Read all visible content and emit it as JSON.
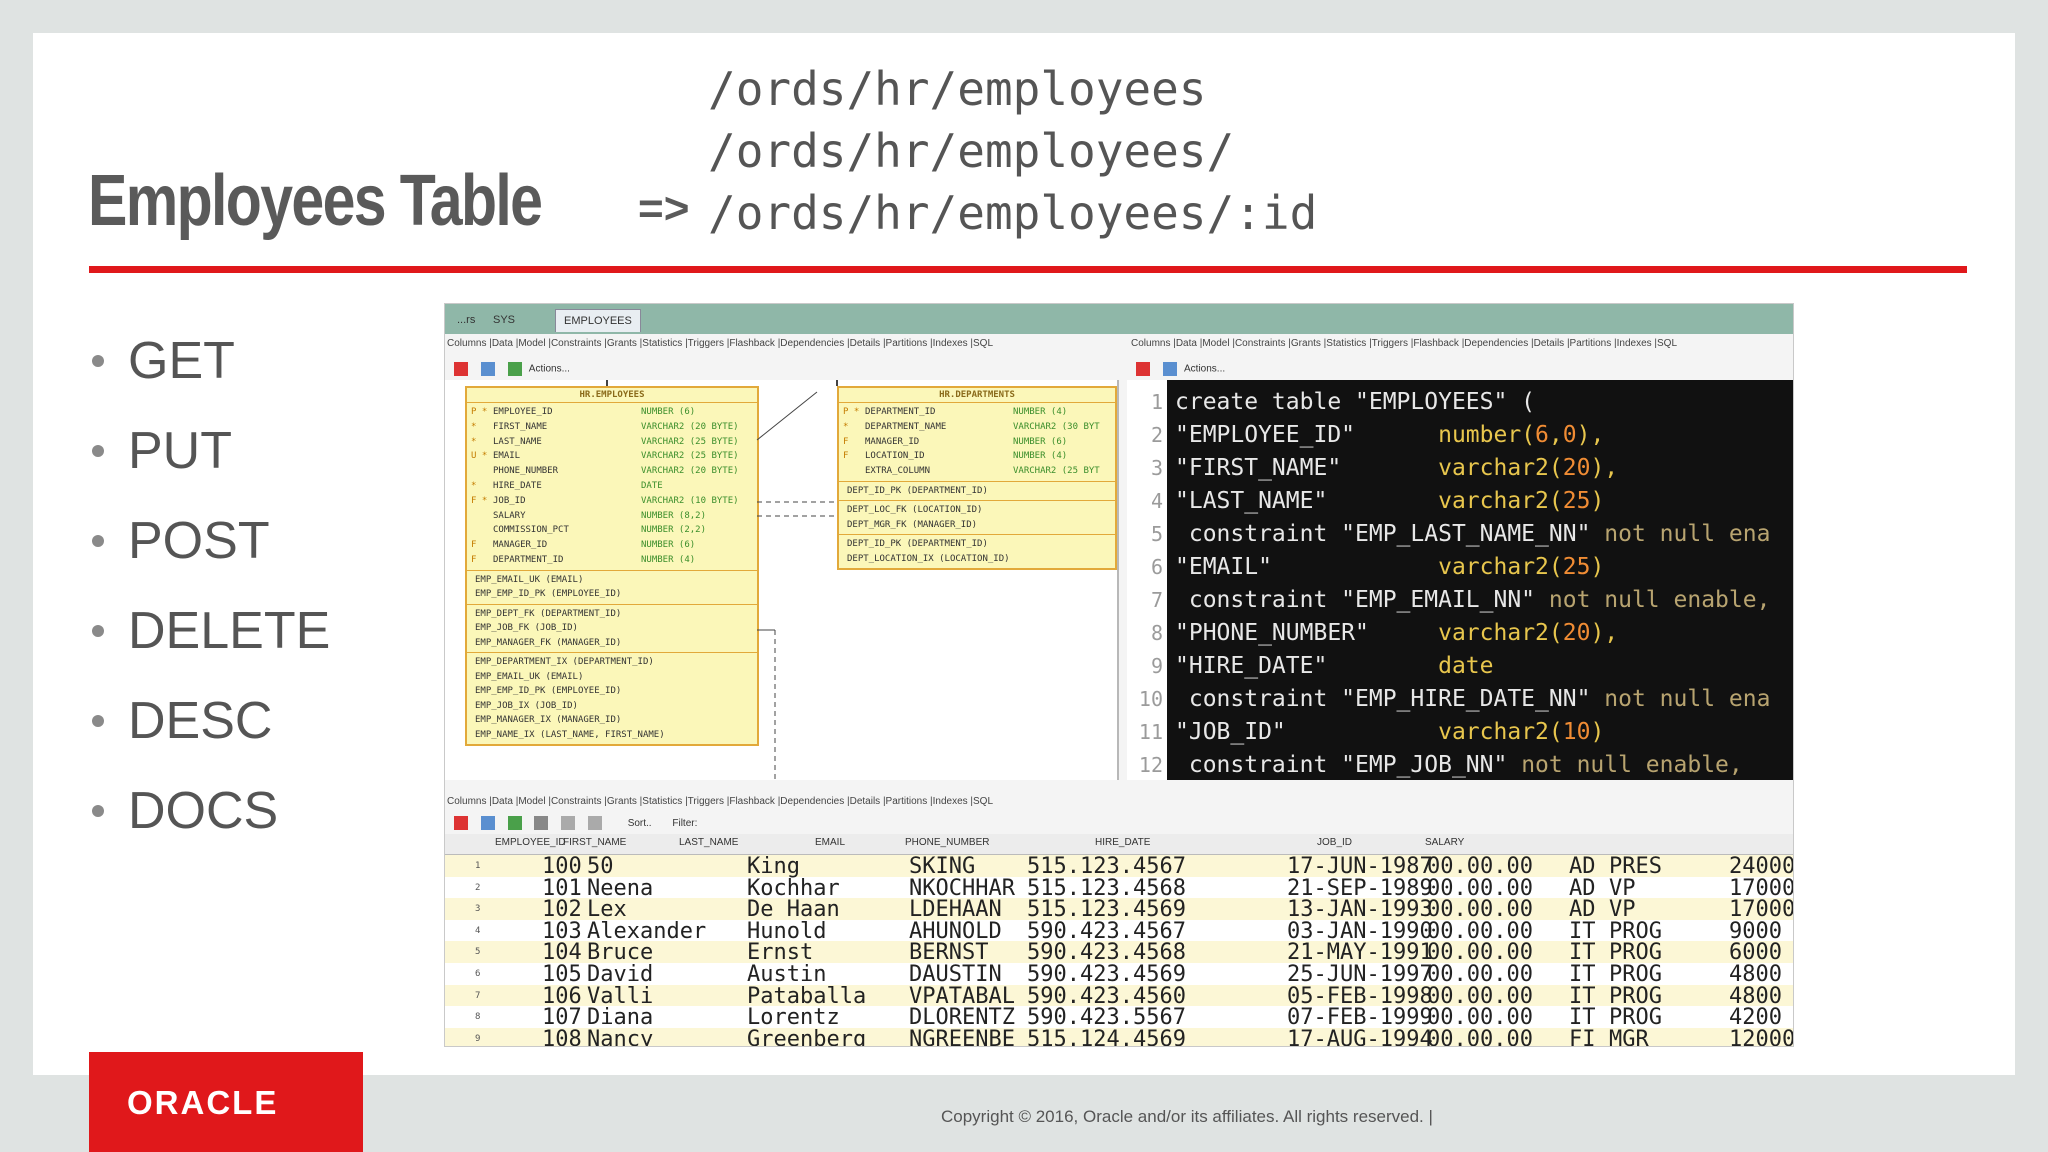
{
  "slide": {
    "title": "Employees Table",
    "arrow": "=>",
    "paths": [
      "/ords/hr/employees",
      "/ords/hr/employees/",
      "/ords/hr/employees/:id"
    ],
    "bullets": [
      "GET",
      "PUT",
      "POST",
      "DELETE",
      "DESC",
      "DOCS"
    ],
    "logo": "ORACLE",
    "copyright": "Copyright © 2016, Oracle and/or its affiliates. All rights reserved.  |"
  },
  "screenshot": {
    "tabs": [
      "...rs",
      "SYS",
      "EMPLOYEES"
    ],
    "subtabs_left": "Columns |Data |Model |Constraints |Grants |Statistics |Triggers |Flashback |Dependencies |Details |Partitions |Indexes |SQL",
    "subtabs_right": "Columns |Data |Model |Constraints |Grants |Statistics |Triggers |Flashback |Dependencies |Details |Partitions |Indexes |SQL",
    "subtabs_bottom": "Columns |Data |Model |Constraints |Grants |Statistics |Triggers |Flashback |Dependencies |Details |Partitions |Indexes |SQL",
    "actions_label": "Actions...",
    "sort_label": "Sort..",
    "filter_label": "Filter:",
    "employees_table": {
      "title": "HR.EMPLOYEES",
      "columns": [
        {
          "key": "P *",
          "name": "EMPLOYEE_ID",
          "type": "NUMBER (6)"
        },
        {
          "key": "*",
          "name": "FIRST_NAME",
          "type": "VARCHAR2 (20 BYTE)"
        },
        {
          "key": "*",
          "name": "LAST_NAME",
          "type": "VARCHAR2 (25 BYTE)"
        },
        {
          "key": "U *",
          "name": "EMAIL",
          "type": "VARCHAR2 (25 BYTE)"
        },
        {
          "key": "",
          "name": "PHONE_NUMBER",
          "type": "VARCHAR2 (20 BYTE)"
        },
        {
          "key": "*",
          "name": "HIRE_DATE",
          "type": "DATE"
        },
        {
          "key": "F *",
          "name": "JOB_ID",
          "type": "VARCHAR2 (10 BYTE)"
        },
        {
          "key": "",
          "name": "SALARY",
          "type": "NUMBER (8,2)"
        },
        {
          "key": "",
          "name": "COMMISSION_PCT",
          "type": "NUMBER (2,2)"
        },
        {
          "key": "F",
          "name": "MANAGER_ID",
          "type": "NUMBER (6)"
        },
        {
          "key": "F",
          "name": "DEPARTMENT_ID",
          "type": "NUMBER (4)"
        }
      ],
      "keys": [
        "EMP_EMAIL_UK (EMAIL)",
        "EMP_EMP_ID_PK (EMPLOYEE_ID)"
      ],
      "fks": [
        "EMP_DEPT_FK (DEPARTMENT_ID)",
        "EMP_JOB_FK (JOB_ID)",
        "EMP_MANAGER_FK (MANAGER_ID)"
      ],
      "indexes": [
        "EMP_DEPARTMENT_IX (DEPARTMENT_ID)",
        "EMP_EMAIL_UK (EMAIL)",
        "EMP_EMP_ID_PK (EMPLOYEE_ID)",
        "EMP_JOB_IX (JOB_ID)",
        "EMP_MANAGER_IX (MANAGER_ID)",
        "EMP_NAME_IX (LAST_NAME, FIRST_NAME)"
      ]
    },
    "departments_table": {
      "title": "HR.DEPARTMENTS",
      "columns": [
        {
          "key": "P *",
          "name": "DEPARTMENT_ID",
          "type": "NUMBER (4)"
        },
        {
          "key": "*",
          "name": "DEPARTMENT_NAME",
          "type": "VARCHAR2 (30 BYT"
        },
        {
          "key": "F",
          "name": "MANAGER_ID",
          "type": "NUMBER (6)"
        },
        {
          "key": "F",
          "name": "LOCATION_ID",
          "type": "NUMBER (4)"
        },
        {
          "key": "",
          "name": "EXTRA_COLUMN",
          "type": "VARCHAR2 (25 BYT"
        }
      ],
      "keys": [
        "DEPT_ID_PK (DEPARTMENT_ID)"
      ],
      "fks": [
        "DEPT_LOC_FK (LOCATION_ID)",
        "DEPT_MGR_FK (MANAGER_ID)"
      ],
      "indexes": [
        "DEPT_ID_PK (DEPARTMENT_ID)",
        "DEPT_LOCATION_IX (LOCATION_ID)"
      ]
    },
    "code_lines": [
      {
        "n": "1",
        "segs": [
          [
            "tx",
            "create table \"EMPLOYEES\" ("
          ]
        ]
      },
      {
        "n": "2",
        "segs": [
          [
            "tx",
            "\"EMPLOYEE_ID\"      "
          ],
          [
            "ty",
            "number("
          ],
          [
            "num",
            "6"
          ],
          [
            "ty",
            ","
          ],
          [
            "num",
            "0"
          ],
          [
            "ty",
            "),"
          ]
        ]
      },
      {
        "n": "3",
        "segs": [
          [
            "tx",
            "\"FIRST_NAME\"       "
          ],
          [
            "ty",
            "varchar2("
          ],
          [
            "num",
            "20"
          ],
          [
            "ty",
            "),"
          ]
        ]
      },
      {
        "n": "4",
        "segs": [
          [
            "tx",
            "\"LAST_NAME\"        "
          ],
          [
            "ty",
            "varchar2("
          ],
          [
            "num",
            "25"
          ],
          [
            "ty",
            ")"
          ]
        ]
      },
      {
        "n": "5",
        "segs": [
          [
            "tx",
            " constraint \"EMP_LAST_NAME_NN\" "
          ],
          [
            "kw",
            "not null ena"
          ]
        ]
      },
      {
        "n": "6",
        "segs": [
          [
            "tx",
            "\"EMAIL\"            "
          ],
          [
            "ty",
            "varchar2("
          ],
          [
            "num",
            "25"
          ],
          [
            "ty",
            ")"
          ]
        ]
      },
      {
        "n": "7",
        "segs": [
          [
            "tx",
            " constraint \"EMP_EMAIL_NN\" "
          ],
          [
            "kw",
            "not null enable,"
          ]
        ]
      },
      {
        "n": "8",
        "segs": [
          [
            "tx",
            "\"PHONE_NUMBER\"     "
          ],
          [
            "ty",
            "varchar2("
          ],
          [
            "num",
            "20"
          ],
          [
            "ty",
            "),"
          ]
        ]
      },
      {
        "n": "9",
        "segs": [
          [
            "tx",
            "\"HIRE_DATE\"        "
          ],
          [
            "ty",
            "date"
          ]
        ]
      },
      {
        "n": "10",
        "segs": [
          [
            "tx",
            " constraint \"EMP_HIRE_DATE_NN\" "
          ],
          [
            "kw",
            "not null ena"
          ]
        ]
      },
      {
        "n": "11",
        "segs": [
          [
            "tx",
            "\"JOB_ID\"           "
          ],
          [
            "ty",
            "varchar2("
          ],
          [
            "num",
            "10"
          ],
          [
            "ty",
            ")"
          ]
        ]
      },
      {
        "n": "12",
        "segs": [
          [
            "tx",
            " constraint \"EMP_JOB_NN\" "
          ],
          [
            "kw",
            "not null enable,"
          ]
        ]
      }
    ],
    "grid_headers": [
      "EMPLOYEE_ID",
      "FIRST_NAME",
      "LAST_NAME",
      "EMAIL",
      "PHONE_NUMBER",
      "HIRE_DATE",
      "JOB_ID",
      "SALARY"
    ],
    "grid_rows": [
      [
        "1",
        "100",
        "50",
        "King",
        "SKING",
        "515.123.4567",
        "17-JUN-1987",
        "00.00.00",
        "AD",
        "PRES",
        "24000"
      ],
      [
        "2",
        "101",
        "Neena",
        "Kochhar",
        "NKOCHHAR",
        "515.123.4568",
        "21-SEP-1989",
        "00.00.00",
        "AD",
        "VP",
        "17000"
      ],
      [
        "3",
        "102",
        "Lex",
        "De Haan",
        "LDEHAAN",
        "515.123.4569",
        "13-JAN-1993",
        "00.00.00",
        "AD",
        "VP",
        "17000"
      ],
      [
        "4",
        "103",
        "Alexander",
        "Hunold",
        "AHUNOLD",
        "590.423.4567",
        "03-JAN-1990",
        "00.00.00",
        "IT",
        "PROG",
        "9000"
      ],
      [
        "5",
        "104",
        "Bruce",
        "Ernst",
        "BERNST",
        "590.423.4568",
        "21-MAY-1991",
        "00.00.00",
        "IT",
        "PROG",
        "6000"
      ],
      [
        "6",
        "105",
        "David",
        "Austin",
        "DAUSTIN",
        "590.423.4569",
        "25-JUN-1997",
        "00.00.00",
        "IT",
        "PROG",
        "4800"
      ],
      [
        "7",
        "106",
        "Valli",
        "Pataballa",
        "VPATABAL",
        "590.423.4560",
        "05-FEB-1998",
        "00.00.00",
        "IT",
        "PROG",
        "4800"
      ],
      [
        "8",
        "107",
        "Diana",
        "Lorentz",
        "DLORENTZ",
        "590.423.5567",
        "07-FEB-1999",
        "00.00.00",
        "IT",
        "PROG",
        "4200"
      ],
      [
        "9",
        "108",
        "Nancy",
        "Greenberg",
        "NGREENBE",
        "515.124.4569",
        "17-AUG-1994",
        "00.00.00",
        "FI",
        "MGR",
        "12000"
      ]
    ]
  }
}
